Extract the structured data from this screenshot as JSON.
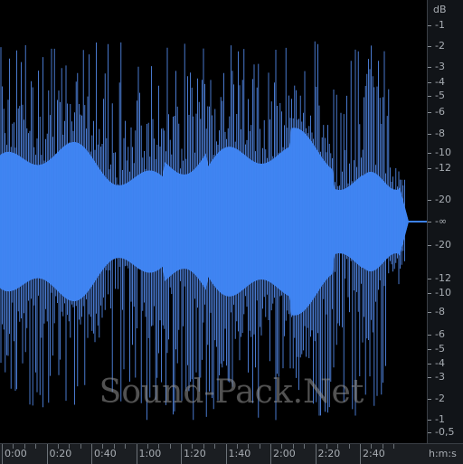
{
  "watermark": "Sound-Pack.Net",
  "colors": {
    "background": "#000000",
    "waveform": "#3d82f0",
    "waveform_edge": "#5b96ff",
    "scale_text": "#a8adb3"
  },
  "db_scale": {
    "unit": "dB",
    "labels_top": [
      "-1",
      "-2",
      "-3",
      "-4",
      "-5",
      "-6",
      "-8",
      "-10",
      "-12",
      "-20"
    ],
    "center": "-∞",
    "labels_bottom": [
      "-20",
      "-12",
      "-10",
      "-8",
      "-6",
      "-5",
      "-4",
      "-3",
      "-2",
      "-1",
      "-0,5"
    ]
  },
  "time_ruler": {
    "labels": [
      "0:00",
      "0:20",
      "0:40",
      "1:00",
      "1:20",
      "1:40",
      "2:00",
      "2:20",
      "2:40"
    ],
    "unit": "h:m:s"
  }
}
